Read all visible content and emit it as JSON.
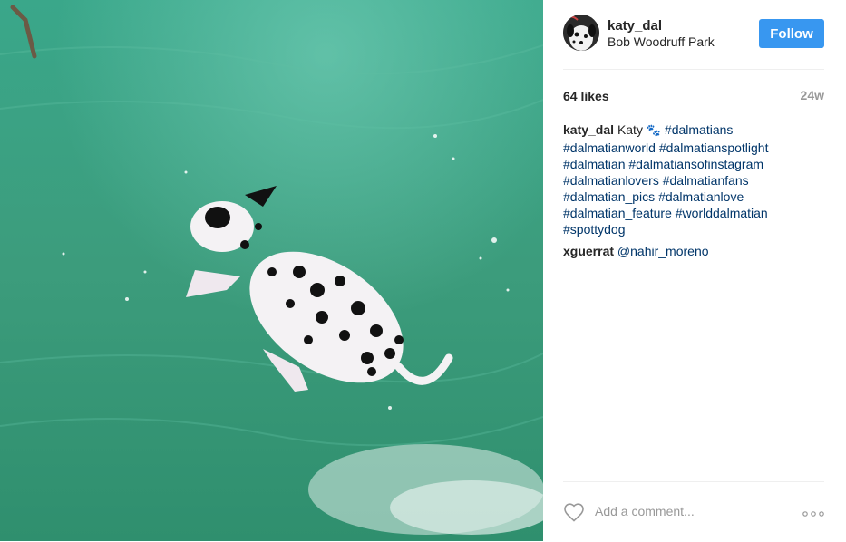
{
  "post": {
    "username": "katy_dal",
    "location": "Bob Woodruff Park",
    "follow_label": "Follow",
    "likes": "64 likes",
    "age": "24w",
    "caption": {
      "author": "katy_dal",
      "text": "Katy",
      "emoji": "🐾",
      "hashtags": [
        "#dalmatians",
        "#dalmatianworld",
        "#dalmatianspotlight",
        "#dalmatian",
        "#dalmatiansofinstagram",
        "#dalmatianlovers",
        "#dalmatianfans",
        "#dalmatian_pics",
        "#dalmatianlove",
        "#dalmatian_feature",
        "#worlddalmatian",
        "#spottydog"
      ]
    },
    "comment": {
      "author": "xguerrat",
      "mention": "@nahir_moreno"
    },
    "add_comment_placeholder": "Add a comment...",
    "photo_subject": "dalmatian jumping into green water"
  },
  "colors": {
    "follow_button": "#3897f0",
    "water": "#3f9a7c",
    "hashtag": "#003569"
  },
  "icons": [
    "heart-icon",
    "more-options-icon",
    "avatar"
  ]
}
